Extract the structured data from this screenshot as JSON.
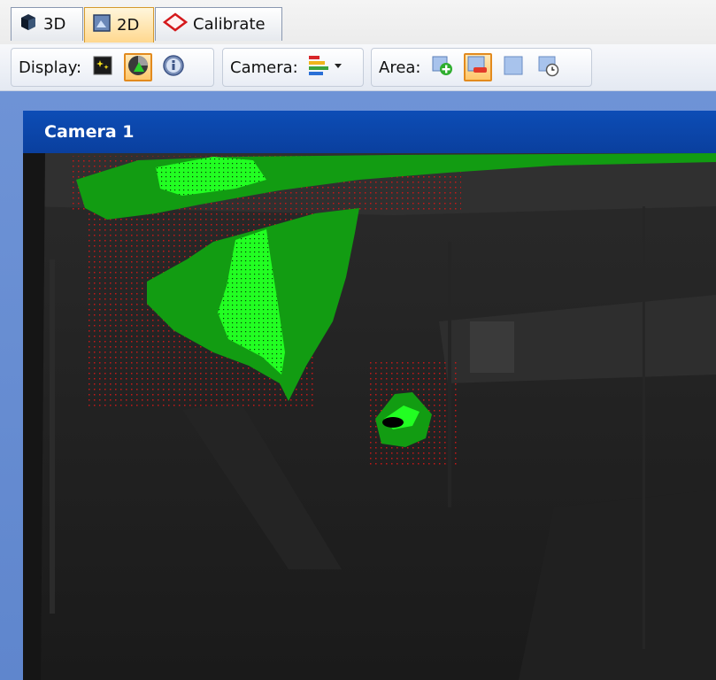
{
  "tabs": [
    {
      "label": "3D",
      "icon": "cube-icon",
      "active": false
    },
    {
      "label": "2D",
      "icon": "image-icon",
      "active": true
    },
    {
      "label": "Calibrate",
      "icon": "diamond-icon",
      "active": false
    }
  ],
  "toolbar": {
    "display_label": "Display:",
    "camera_label": "Camera:",
    "area_label": "Area:"
  },
  "panel": {
    "title": "Camera 1"
  },
  "colors": {
    "header_blue": "#0a4aae",
    "detect_green": "#129c12",
    "detect_bright": "#22ff22",
    "grid_red": "#c41818",
    "active_orange": "#e28a1e"
  }
}
